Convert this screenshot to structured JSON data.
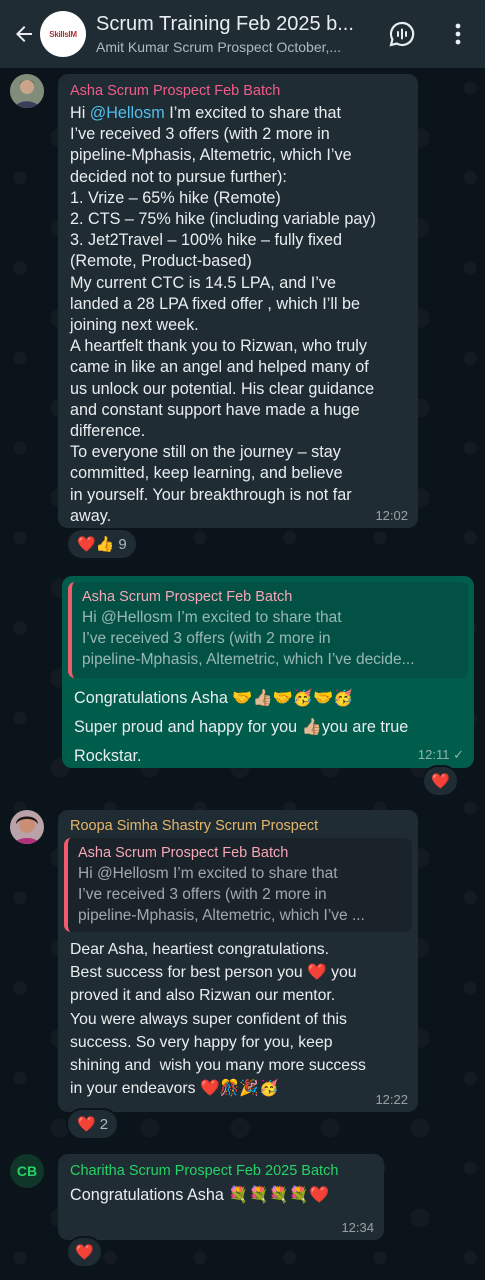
{
  "header": {
    "title": "Scrum Training Feb 2025 b...",
    "subtitle": "Amit Kumar Scrum Prospect October,...",
    "logo_text": "SkillsIM"
  },
  "messages": [
    {
      "sender": "Asha Scrum Prospect Feb Batch",
      "sender_color": "#f15c8b",
      "text_pre": "Hi ",
      "mention": "@Hellosm",
      "text": " I’m excited to share that\nI’ve received 3 offers (with 2 more in\npipeline-Mphasis, Altemetric, which I’ve\ndecided not to pursue further):\n1. Vrize – 65% hike (Remote)\n2. CTS – 75% hike (including variable pay)\n3. Jet2Travel – 100% hike – fully fixed\n(Remote, Product-based)\nMy current CTC is 14.5 LPA, and I’ve\nlanded a 28 LPA fixed offer , which I’ll be\njoining next week.\nA heartfelt thank you to Rizwan, who truly\ncame in like an angel and helped many of\nus unlock our potential. His clear guidance\nand constant support have made a huge\ndifference.\nTo everyone still on the journey – stay\ncommitted, keep learning, and believe\nin yourself. Your breakthrough is not far\naway.",
      "time": "12:02",
      "reaction": {
        "emoji": "❤️👍",
        "count": "9"
      }
    },
    {
      "quote_name": "Asha Scrum Prospect Feb Batch",
      "quote_text": "Hi @Hellosm I’m excited to share that\nI’ve received 3 offers (with 2 more in\npipeline-Mphasis, Altemetric, which I’ve decide...",
      "text": "Congratulations Asha 🤝👍🏼🤝🥳🤝🥳\nSuper proud and happy for you 👍🏼you are true\nRockstar.",
      "time": "12:11 ✓",
      "reaction": {
        "emoji": "❤️",
        "count": ""
      }
    },
    {
      "sender": "Roopa Simha Shastry Scrum Prospect",
      "sender_color": "#e5b56b",
      "quote_name": "Asha Scrum Prospect Feb Batch",
      "quote_text": "Hi @Hellosm I’m excited to share that\nI’ve received 3 offers (with 2 more in\npipeline-Mphasis, Altemetric, which I’ve ...",
      "text": "Dear Asha, heartiest congratulations.\nBest success for best person you ❤️ you\nproved it and also Rizwan our mentor.\nYou were always super confident of this\nsuccess. So very happy for you, keep\nshining and  wish you many more success\nin your endeavors ❤️🎊🎉🥳",
      "time": "12:22",
      "reaction": {
        "emoji": "❤️",
        "count": "2"
      }
    },
    {
      "sender": "Charitha Scrum Prospect Feb 2025 Batch",
      "sender_color": "#25d366",
      "avatar_initials": "CB",
      "text": "Congratulations Asha 💐💐💐💐❤️",
      "time": "12:34",
      "reaction": {
        "emoji": "❤️",
        "count": ""
      }
    }
  ]
}
